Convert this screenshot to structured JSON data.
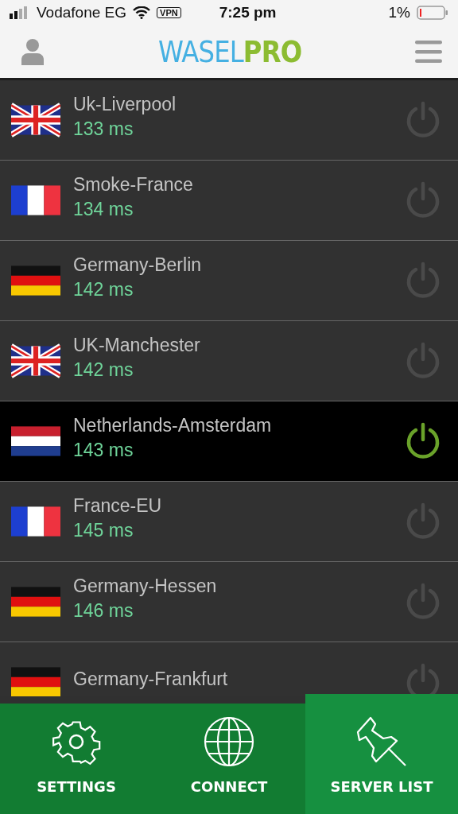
{
  "status_bar": {
    "carrier": "Vodafone EG",
    "vpn": "VPN",
    "time": "7:25 pm",
    "battery": "1%"
  },
  "header": {
    "logo_left": "WASEL",
    "logo_right": "PRO"
  },
  "servers": [
    {
      "kind": "uk",
      "name": "Uk-Liverpool",
      "latency": "133 ms",
      "selected": false
    },
    {
      "kind": "fr",
      "name": "Smoke-France",
      "latency": "134 ms",
      "selected": false
    },
    {
      "kind": "de",
      "name": "Germany-Berlin",
      "latency": "142 ms",
      "selected": false
    },
    {
      "kind": "uk",
      "name": "UK-Manchester",
      "latency": "142 ms",
      "selected": false
    },
    {
      "kind": "nl",
      "name": "Netherlands-Amsterdam",
      "latency": "143 ms",
      "selected": true
    },
    {
      "kind": "fr",
      "name": "France-EU",
      "latency": "145 ms",
      "selected": false
    },
    {
      "kind": "de",
      "name": "Germany-Hessen",
      "latency": "146 ms",
      "selected": false
    },
    {
      "kind": "de",
      "name": "Germany-Frankfurt",
      "selected": false
    }
  ],
  "nav": [
    {
      "kind": "settings",
      "label": "SETTINGS",
      "selected": false
    },
    {
      "kind": "connect",
      "label": "CONNECT",
      "selected": false
    },
    {
      "kind": "servers",
      "label": "SERVER LIST",
      "selected": true
    }
  ]
}
